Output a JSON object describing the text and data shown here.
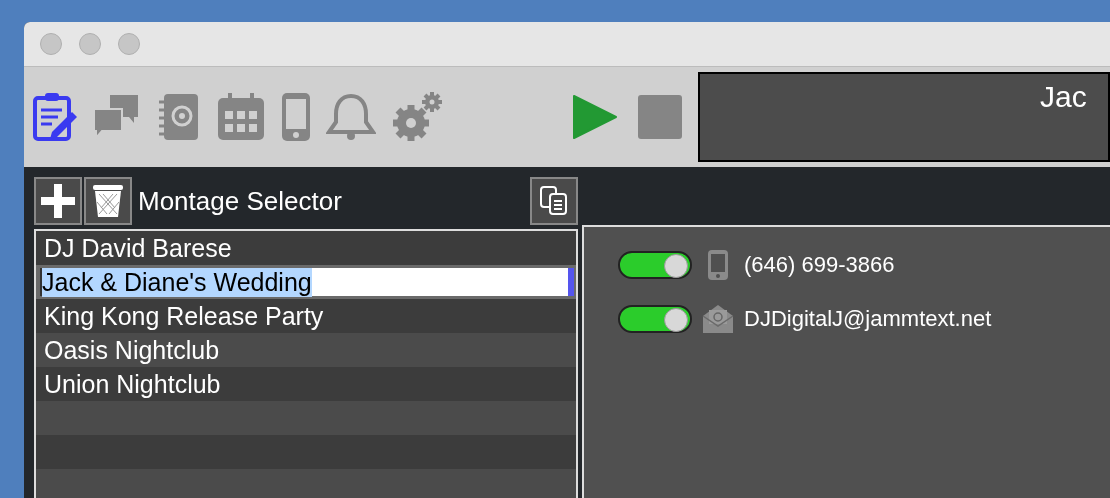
{
  "toolbar": {
    "tools": [
      {
        "kind": "notes",
        "selected": true
      },
      {
        "kind": "chat",
        "selected": false
      },
      {
        "kind": "contacts",
        "selected": false
      },
      {
        "kind": "calendar",
        "selected": false
      },
      {
        "kind": "phone",
        "selected": false
      },
      {
        "kind": "bell",
        "selected": false
      },
      {
        "kind": "settings",
        "selected": false
      }
    ],
    "display": "Jac"
  },
  "montage_selector": {
    "title": "Montage Selector",
    "items": [
      {
        "label": "DJ David Barese",
        "selected": false
      },
      {
        "label": "Jack & Diane's Wedding",
        "selected": true
      },
      {
        "label": "King Kong Release Party",
        "selected": false
      },
      {
        "label": "Oasis Nightclub",
        "selected": false
      },
      {
        "label": "Union Nightclub",
        "selected": false
      }
    ]
  },
  "contacts": [
    {
      "kind": "phone",
      "on": true,
      "value": "(646) 699-3866"
    },
    {
      "kind": "email",
      "on": true,
      "value": "DJDigitalJ@jammtext.net"
    }
  ]
}
